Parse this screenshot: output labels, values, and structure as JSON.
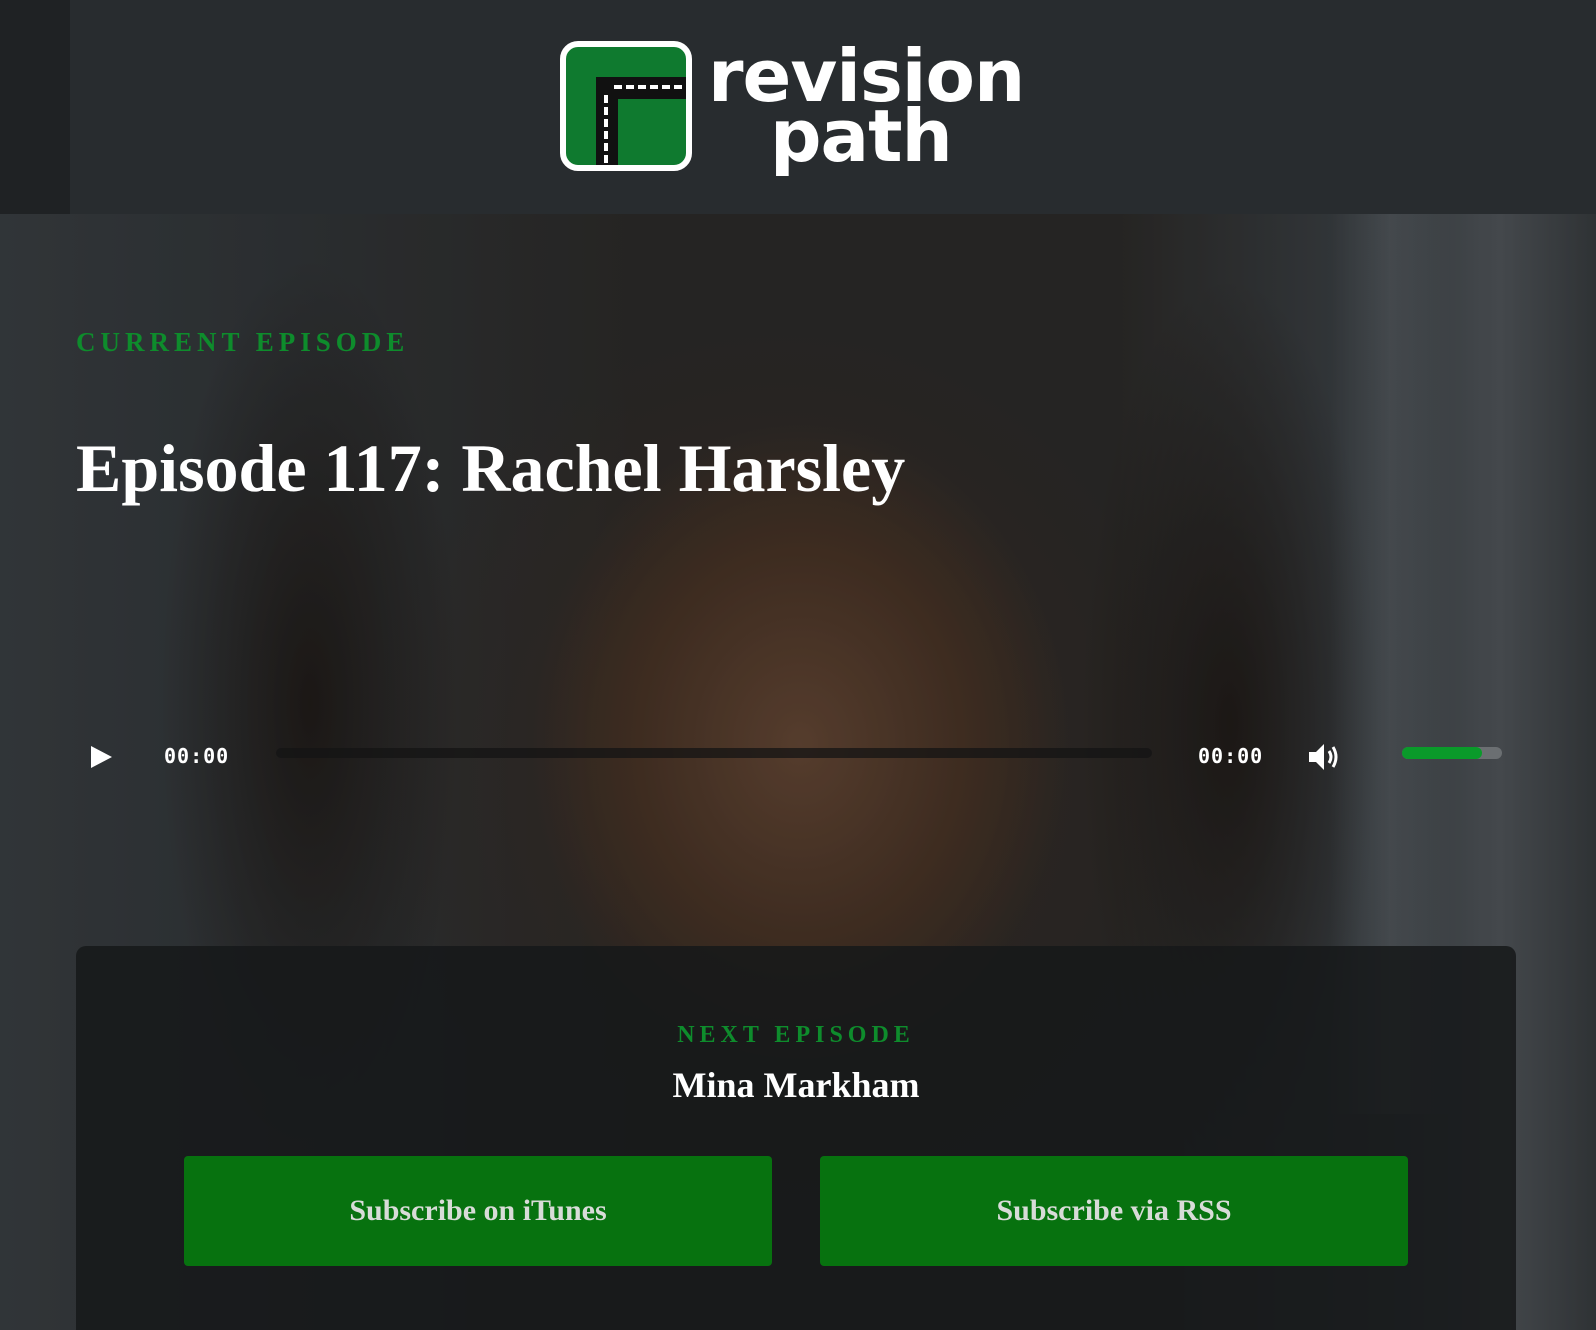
{
  "brand": {
    "logo_line1": "revision",
    "logo_line2": "path",
    "accent_color": "#0e8c2c"
  },
  "current_episode": {
    "label": "CURRENT EPISODE",
    "title": "Episode 117: Rachel Harsley"
  },
  "player": {
    "play_icon": "play-icon",
    "current_time": "00:00",
    "total_time": "00:00",
    "progress": 0,
    "volume_icon": "volume-icon",
    "volume_level": 0.8
  },
  "next_episode": {
    "label": "NEXT EPISODE",
    "name": "Mina Markham"
  },
  "subscribe": {
    "itunes_label": "Subscribe on iTunes",
    "rss_label": "Subscribe via RSS",
    "button_color": "#07720f"
  }
}
